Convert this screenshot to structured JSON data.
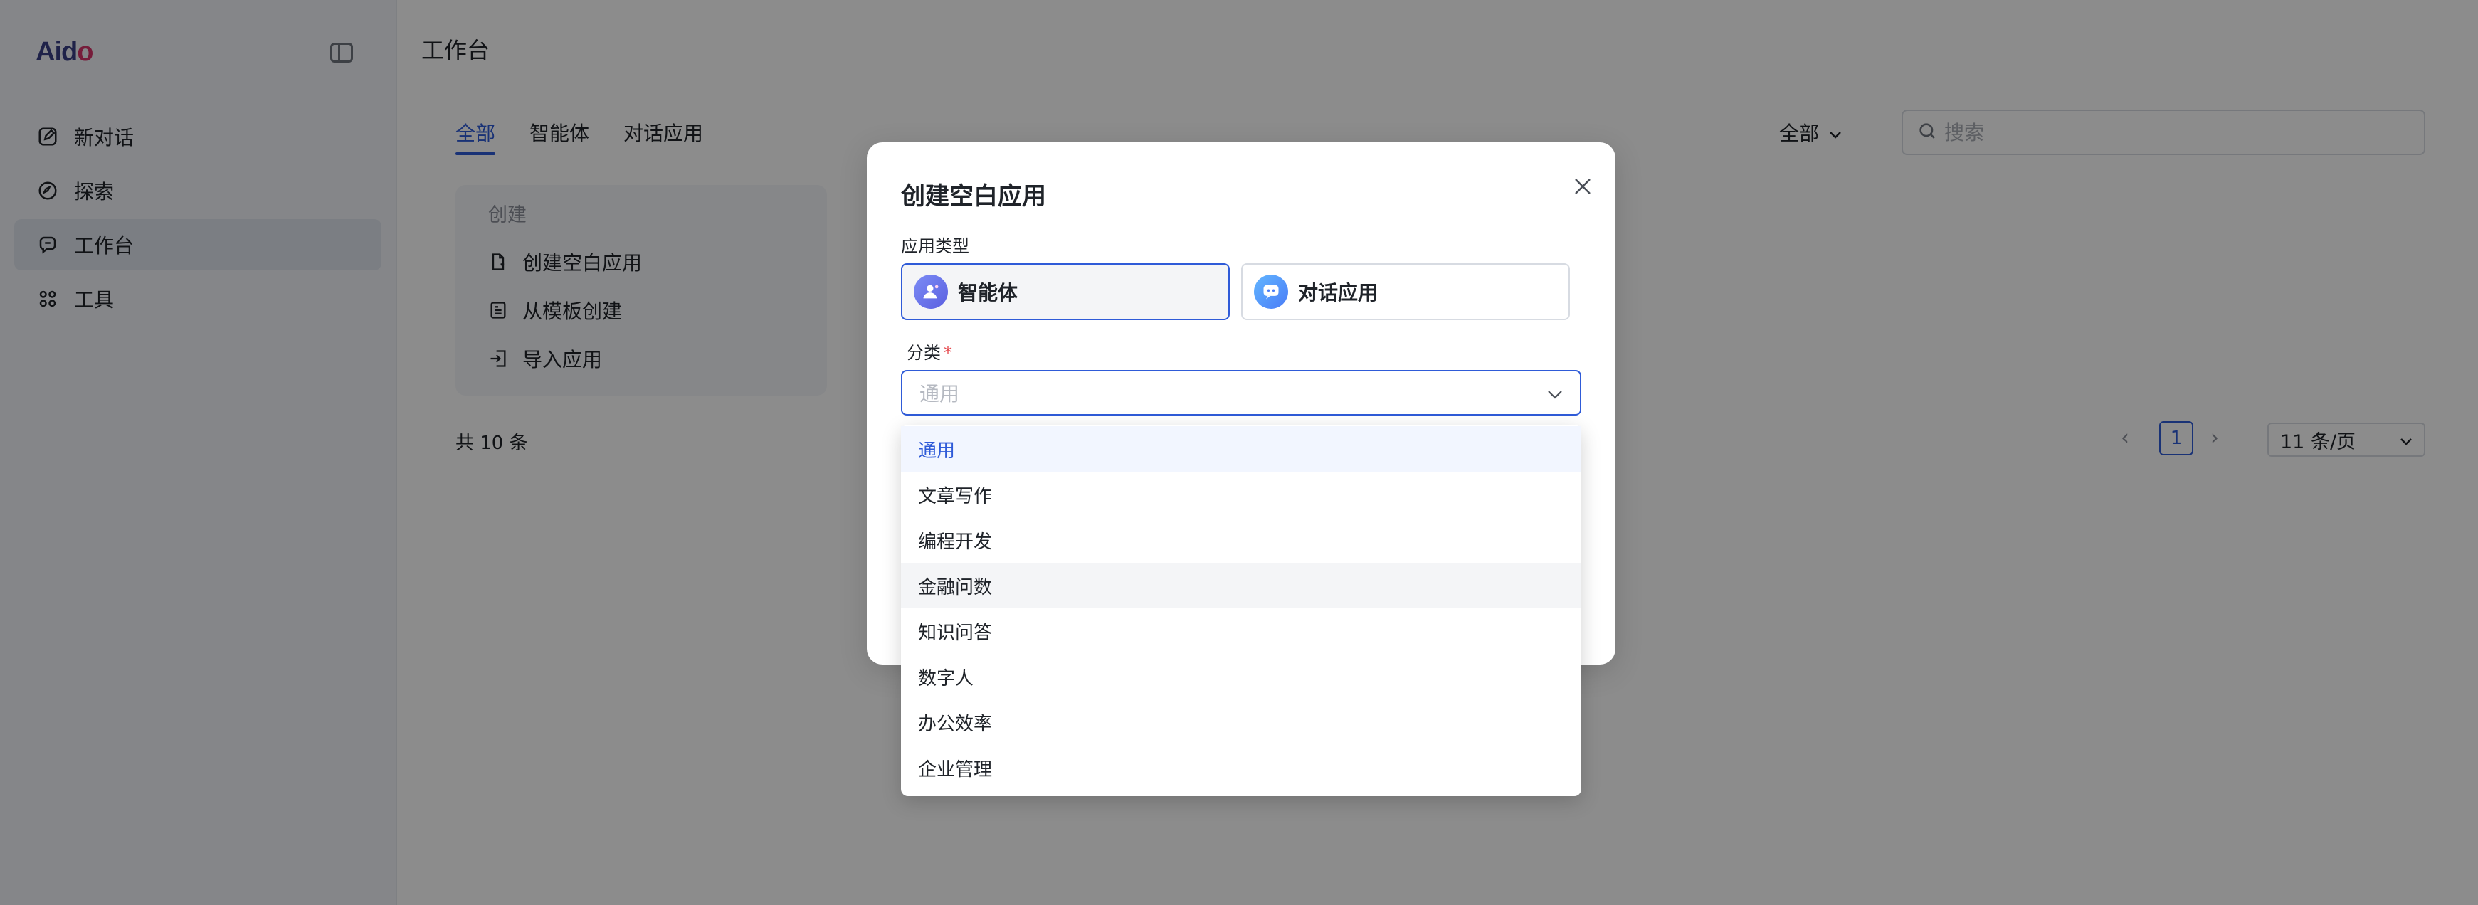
{
  "app": {
    "logo_text_a": "Aid",
    "logo_text_b": "o"
  },
  "sidebar": {
    "items": [
      {
        "label": "新对话",
        "icon": "edit-icon"
      },
      {
        "label": "探索",
        "icon": "compass-icon"
      },
      {
        "label": "工作台",
        "icon": "workspace-icon",
        "active": true
      },
      {
        "label": "工具",
        "icon": "grid-icon"
      }
    ]
  },
  "main": {
    "title": "工作台",
    "tabs": [
      {
        "label": "全部",
        "active": true
      },
      {
        "label": "智能体"
      },
      {
        "label": "对话应用"
      }
    ],
    "filter_label": "全部",
    "search_placeholder": "搜索",
    "create_card": {
      "title": "创建",
      "items": [
        {
          "label": "创建空白应用"
        },
        {
          "label": "从模板创建"
        },
        {
          "label": "导入应用"
        }
      ]
    },
    "total_text": "共 10 条",
    "pagination": {
      "current_page": "1",
      "page_size": "11 条/页"
    }
  },
  "modal": {
    "title": "创建空白应用",
    "type_label": "应用类型",
    "types": [
      {
        "label": "智能体",
        "selected": true
      },
      {
        "label": "对话应用"
      }
    ],
    "category_label": "分类",
    "category_required_mark": "*",
    "category_placeholder": "通用"
  },
  "dropdown": {
    "options": [
      "通用",
      "文章写作",
      "编程开发",
      "金融问数",
      "知识问答",
      "数字人",
      "办公效率",
      "企业管理"
    ],
    "selected_index": 0,
    "hover_index": 3
  },
  "colors": {
    "accent": "#2f5bd8",
    "overlay": "rgba(0,0,0,0.45)",
    "required": "#e5484d"
  }
}
